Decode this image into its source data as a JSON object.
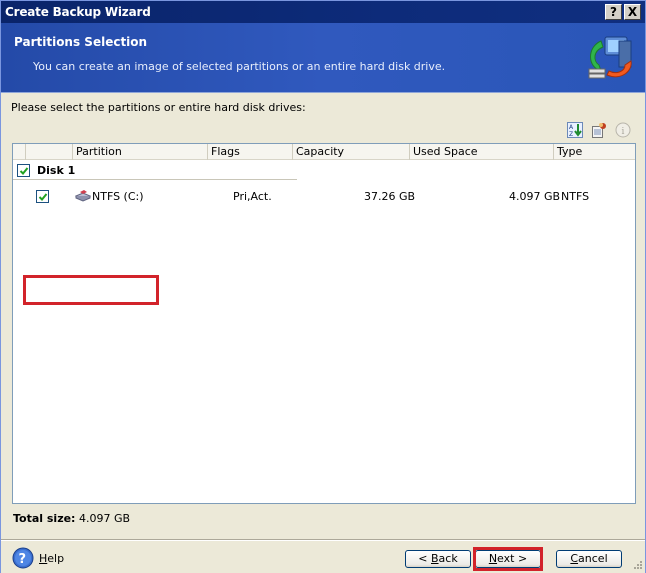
{
  "window": {
    "title": "Create Backup Wizard",
    "help_button": "?",
    "close_button": "X"
  },
  "header": {
    "title": "Partitions Selection",
    "subtitle": "You can create an image of selected partitions or an entire hard disk drive.",
    "icon": "backup-computer-icon"
  },
  "content": {
    "prompt": "Please select the partitions or entire hard disk drives:",
    "toolbar": [
      {
        "icon": "sort-az-icon"
      },
      {
        "icon": "properties-icon"
      },
      {
        "icon": "info-icon"
      }
    ],
    "columns": [
      "Partition",
      "Flags",
      "Capacity",
      "Used Space",
      "Type"
    ],
    "disks": [
      {
        "label": "Disk 1",
        "checked": true,
        "partitions": [
          {
            "name": "NTFS (C:)",
            "flags": "Pri,Act.",
            "capacity": "37.26 GB",
            "used_space": "4.097 GB",
            "type": "NTFS",
            "checked": true,
            "highlighted": true
          }
        ]
      }
    ],
    "total_label": "Total size:",
    "total_value": "4.097 GB"
  },
  "footer": {
    "help_label": "Help",
    "help_accel": "H",
    "help_rest": "elp",
    "back": {
      "prefix": "< ",
      "accel": "B",
      "rest": "ack"
    },
    "next": {
      "accel": "N",
      "rest": "ext >",
      "highlighted": true
    },
    "cancel": {
      "accel": "C",
      "rest": "ancel"
    }
  },
  "colors": {
    "highlight": "#d2232a",
    "title_bar": "#0a246a",
    "header_bg": "#2f58bc"
  }
}
